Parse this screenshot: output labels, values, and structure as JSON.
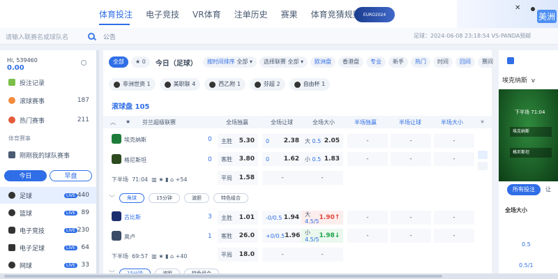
{
  "nav": {
    "items": [
      "体育投注",
      "电子竞技",
      "VR体育",
      "注单历史",
      "赛果",
      "体育竞猜规则"
    ],
    "euro": "EURO2024"
  },
  "promo": {
    "label": "美洲"
  },
  "search": {
    "placeholder": "请输入联赛名或球队名"
  },
  "notice": "公告",
  "marquee": "足球：2024-06-08 23:18:54 VS-PANDA预邮",
  "user": {
    "name": "Hi, 539460",
    "balance": "0.00"
  },
  "sidebar": {
    "items": [
      {
        "label": "投注记录",
        "count": ""
      },
      {
        "label": "滚球赛事",
        "count": "187"
      },
      {
        "label": "热门赛事",
        "count": "211"
      }
    ],
    "section": "体育赛事",
    "fav": "刚刚我的球队赛事",
    "day_tabs": [
      "今日",
      "早盘"
    ],
    "sports": [
      {
        "label": "足球",
        "count": "440"
      },
      {
        "label": "篮球",
        "count": "89"
      },
      {
        "label": "电子竞技",
        "count": "230"
      },
      {
        "label": "电子足球",
        "count": "64"
      },
      {
        "label": "网球",
        "count": "33"
      }
    ],
    "live": "LIVE"
  },
  "filters": {
    "all": "全部",
    "star_count": "0",
    "today": "今日（足球）",
    "sort": "按时间排序",
    "sort_val": "全部",
    "league": "选择联赛",
    "league_val": "全部",
    "odds": "欧洲盘",
    "odds2": "香港盘",
    "mode1": "专业",
    "mode2": "新手",
    "t1": "热门",
    "t2": "时间",
    "t3": "回间",
    "t4": "赛间"
  },
  "chips": [
    {
      "label": "非洲世资",
      "count": "1"
    },
    {
      "label": "美职联",
      "count": "4"
    },
    {
      "label": "西乙附",
      "count": "1"
    },
    {
      "label": "芬超",
      "count": "2"
    },
    {
      "label": "自由杯",
      "count": "1"
    }
  ],
  "section_title": "滚球盘 105",
  "table_head": {
    "league": "芬兰超级联赛",
    "c1": "全场独赢",
    "c2": "全场让球",
    "c3": "全场大小",
    "c4": "半场独赢",
    "c5": "半场让球",
    "c6": "半场大小"
  },
  "match1": {
    "home": "埃克纳斯",
    "away": "格尼斯坦",
    "hs": "0",
    "as": "0",
    "win_h_k": "主胜",
    "win_h": "5.30",
    "win_a_k": "客胜",
    "win_a": "3.80",
    "draw_k": "平局",
    "draw": "1.58",
    "hc_h_k": "0",
    "hc_h": "2.38",
    "hc_a_k": "0",
    "hc_a": "1.62",
    "ou_h_k": "大",
    "ou_h_l": "0.5",
    "ou_h": "2.05",
    "ou_a_k": "小",
    "ou_a_l": "0.5",
    "ou_a": "1.83",
    "period": "下半场",
    "time": "71:04",
    "more": "+54",
    "tabs": [
      "角球",
      "15分钟",
      "波胆",
      "特色组合"
    ]
  },
  "match2": {
    "home": "古比斯",
    "away": "奥卢",
    "hs": "3",
    "as": "1",
    "win_h_k": "主胜",
    "win_h": "1.01",
    "win_a_k": "客胜",
    "win_a": "26.0",
    "draw_k": "平局",
    "draw": "18.0",
    "hc_h_k": "-0/0.5",
    "hc_h": "1.94",
    "hc_a_k": "+0/0.5",
    "hc_a": "1.96",
    "ou_h_k": "大",
    "ou_h_l": "4.5/5",
    "ou_h": "1.90",
    "ou_a_k": "小",
    "ou_a_l": "4.5/5",
    "ou_a": "1.98",
    "period": "下半场",
    "time": "69:57",
    "more": "+40",
    "tabs": [
      "15分钟",
      "波胆",
      "特色组合"
    ]
  },
  "dash": "-",
  "right": {
    "team": "埃克纳斯",
    "v": "v",
    "video_period": "下半场",
    "video_time": "71:04",
    "v_home": "埃克纳斯",
    "v_away": "格尼斯坦",
    "tab_all": "所有投注",
    "tab2": "让",
    "head": "全场大小",
    "val1": "0.5",
    "val2": "0.5/1"
  },
  "colors": {
    "accent": "#2f6ee6",
    "up": "#1ea34b",
    "down": "#e0463c"
  }
}
